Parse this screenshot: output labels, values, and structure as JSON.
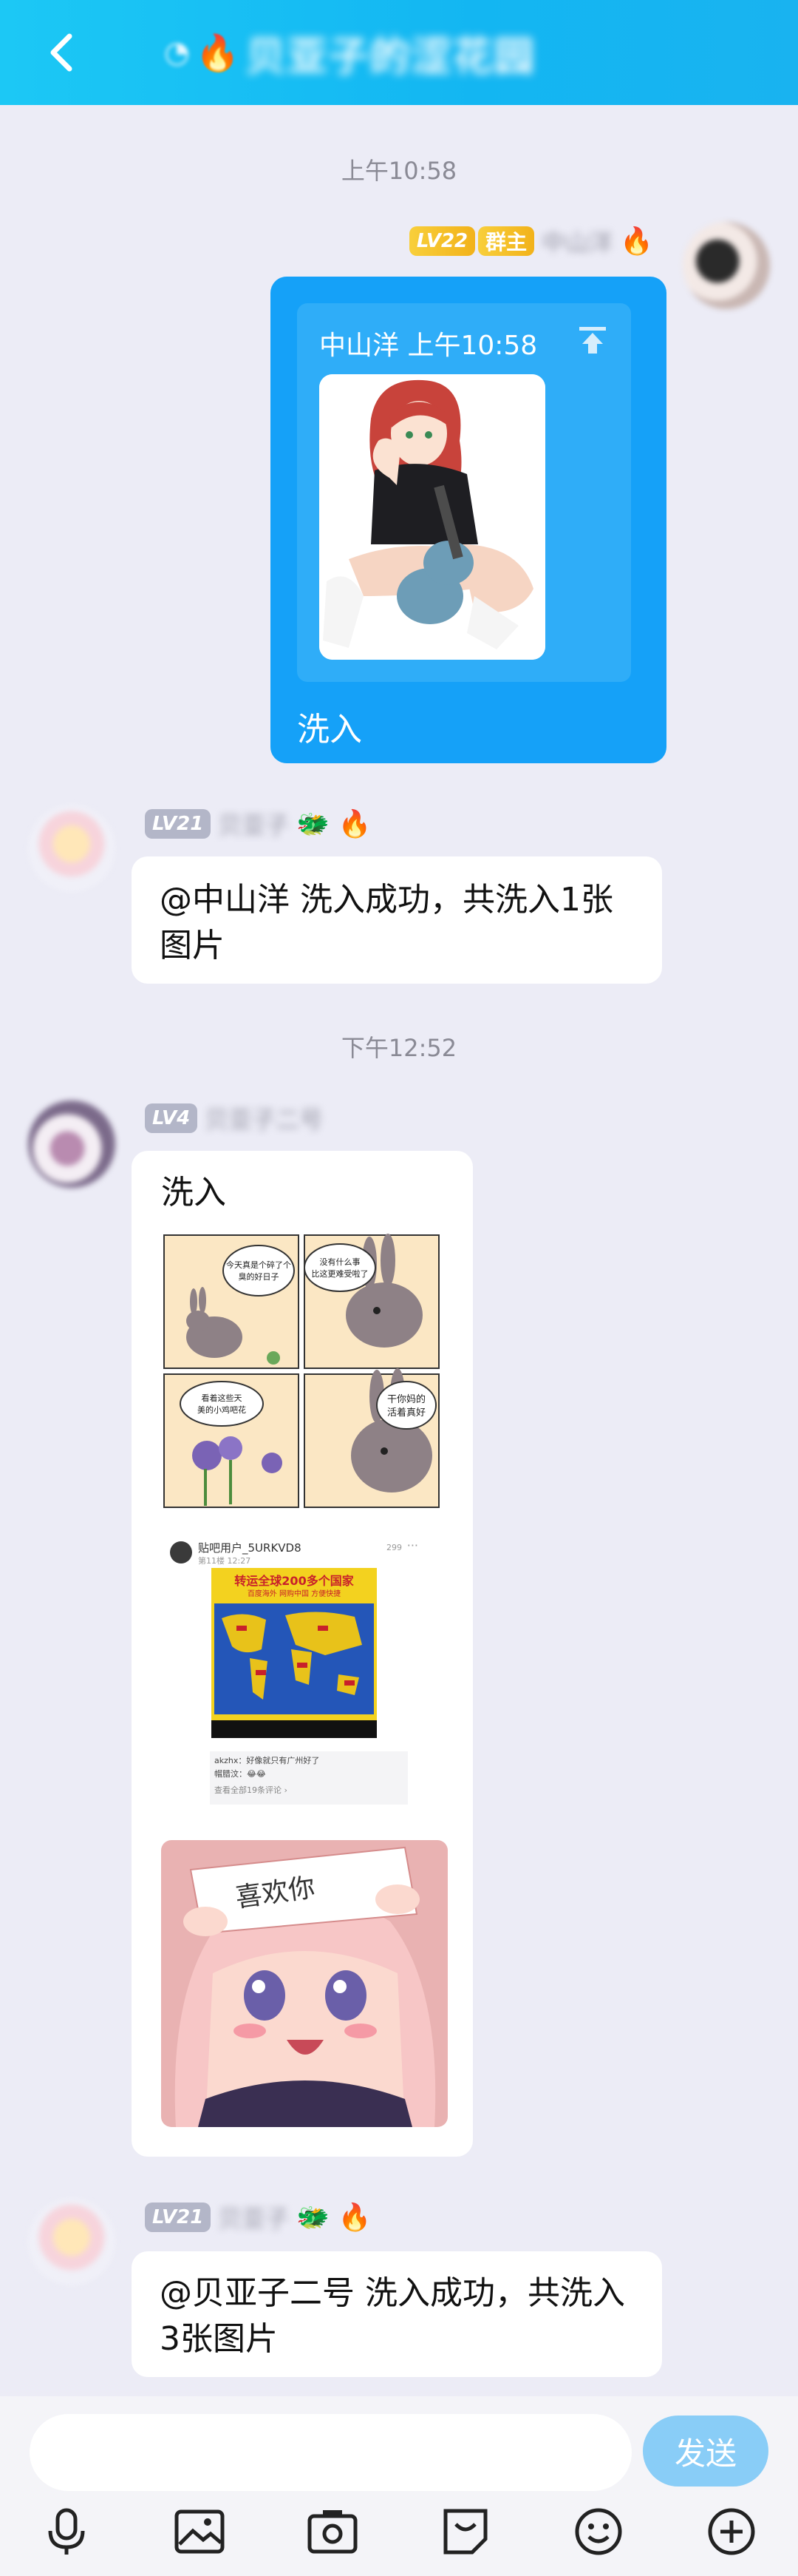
{
  "header": {
    "title": "贝亚子的涩花园",
    "back_icon": "chevron-left-icon"
  },
  "timestamps": [
    "上午10:58",
    "下午12:52"
  ],
  "messages": {
    "m1": {
      "level": "LV22",
      "role": "群主",
      "name": "中山洋",
      "badge_emoji": "🔥",
      "forward_header": "中山洋 上午10:58",
      "caption": "洗入"
    },
    "m2": {
      "level": "LV21",
      "name": "贝亚子",
      "badge_emojis": "🐲 🔥",
      "text": "@中山洋  洗入成功，共洗入1张图片"
    },
    "m3": {
      "level": "LV4",
      "name": "贝亚子二号",
      "text": "洗入",
      "comic_bubbles": [
        "今天真是个碎了个臭的好日子",
        "没有什么事比这更难受啦了",
        "看着这些天美的小鸡吧花",
        "干你妈的活着真好"
      ],
      "post": {
        "user": "贴吧用户_5URKVD8",
        "meta": "第11楼  12:27",
        "likes": "299",
        "poster_title": "转运全球200多个国家",
        "poster_sub": "百度海外  网购中国  方便快捷",
        "comment1": "akzhx：好像就只有广州好了",
        "comment2": "帽腊汶：😂😂",
        "more": "查看全部19条评论 ›"
      },
      "anime_card_text": "喜欢你"
    },
    "m4": {
      "level": "LV21",
      "name": "贝亚子",
      "badge_emojis": "🐲 🔥",
      "text": "@贝亚子二号  洗入成功，共洗入3张图片"
    }
  },
  "composer": {
    "placeholder": "",
    "send_label": "发送"
  },
  "toolbar": [
    "mic-icon",
    "image-icon",
    "camera-icon",
    "sticker-icon",
    "emoji-icon",
    "plus-icon"
  ]
}
